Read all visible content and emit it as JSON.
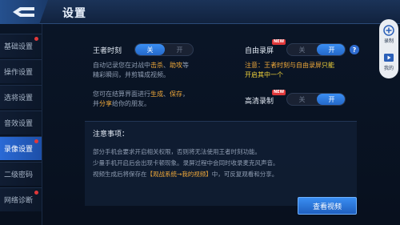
{
  "header": {
    "title": "设置"
  },
  "sidebar": {
    "items": [
      {
        "label": "基础设置",
        "badge": true
      },
      {
        "label": "操作设置",
        "badge": false
      },
      {
        "label": "选将设置",
        "badge": false
      },
      {
        "label": "音效设置",
        "badge": false
      },
      {
        "label": "录像设置",
        "badge": true,
        "active": true
      },
      {
        "label": "二级密码",
        "badge": false
      },
      {
        "label": "网络诊断",
        "badge": true
      }
    ]
  },
  "settings": {
    "king_moment": {
      "label": "王者时刻",
      "options": [
        "关",
        "开"
      ],
      "selected": "关",
      "desc1_a": "自动记录您在对战中",
      "desc1_kill": "击杀",
      "desc1_sep": "、",
      "desc1_assist": "助攻",
      "desc1_b": "等",
      "desc2": "精彩瞬间，并剪辑成视频。",
      "desc3_a": "您可在结算界面进行",
      "desc3_gen": "生成",
      "desc3_sep": "、",
      "desc3_save": "保存",
      "desc3_b": "，",
      "desc4_a": "并",
      "desc4_share": "分享",
      "desc4_b": "给你的朋友。"
    },
    "free_record": {
      "label": "自由录屏",
      "badge": "NEW",
      "options": [
        "关",
        "开"
      ],
      "selected": "开",
      "note_a": "注意：王者时刻与自由录屏",
      "note_b": "只能",
      "note_c": "开启其中一个",
      "help": "?"
    },
    "hd_record": {
      "label": "高清录制",
      "badge": "NEW",
      "options": [
        "关",
        "开"
      ],
      "selected": "开"
    }
  },
  "notice": {
    "title": "注意事项：",
    "line1": "部分手机会要求开启相关权限，否则将无法使用王者时刻功能。",
    "line2": "少量手机开启后会出现卡顿现象。录屏过程中会同时收录麦克风声音。",
    "line3_a": "视频生成后将保存在",
    "line3_path": "【观战系统→我的视频】",
    "line3_b": "中，可反复观看和分享。"
  },
  "view_button": "查看视频",
  "right_panel": {
    "record_label": "录制",
    "mine_label": "我的"
  },
  "colors": {
    "accent": "#2f7ee8",
    "highlight": "#f0a93a",
    "badge": "#e0383a"
  }
}
